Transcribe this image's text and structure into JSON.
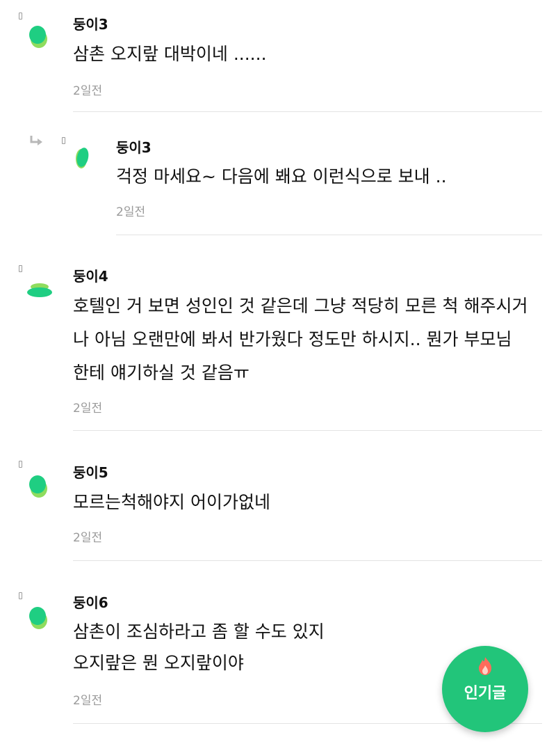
{
  "comments": [
    {
      "author": "둥이3",
      "lines": [
        "삼촌 오지랖 대박이네 ......"
      ],
      "time": "2일전"
    },
    {
      "author": "둥이3",
      "lines": [
        "걱정 마세요~ 다음에 봬요 이런식으로 보내 .."
      ],
      "time": "2일전"
    },
    {
      "author": "둥이4",
      "lines": [
        "호텔인 거 보면 성인인 것 같은데 그냥 적당히 모른 척 해주시거",
        "나 아님 오랜만에 봐서 반가웠다 정도만 하시지.. 뭔가 부모님",
        "한테 얘기하실 것 같음ㅠ"
      ],
      "time": "2일전"
    },
    {
      "author": "둥이5",
      "lines": [
        "모르는척해야지 어이가없네"
      ],
      "time": "2일전"
    },
    {
      "author": "둥이6",
      "lines": [
        "삼촌이 조심하라고 좀 할 수도 있지",
        "오지랖은 뭔 오지랖이야"
      ],
      "time": "2일전"
    }
  ],
  "fab": {
    "label": "인기글",
    "icon": "flame-icon"
  },
  "colors": {
    "accent_green": "#22c57a",
    "avatar_green": "#1fce82",
    "avatar_lime": "#8fdc5e",
    "meta_gray": "#9a9a9a",
    "divider": "#e3e3e3"
  },
  "icons": {
    "avatar": "leaf-avatar-icon",
    "reply": "reply-arrow-icon",
    "report_marker": "bookmark-marker-icon"
  }
}
